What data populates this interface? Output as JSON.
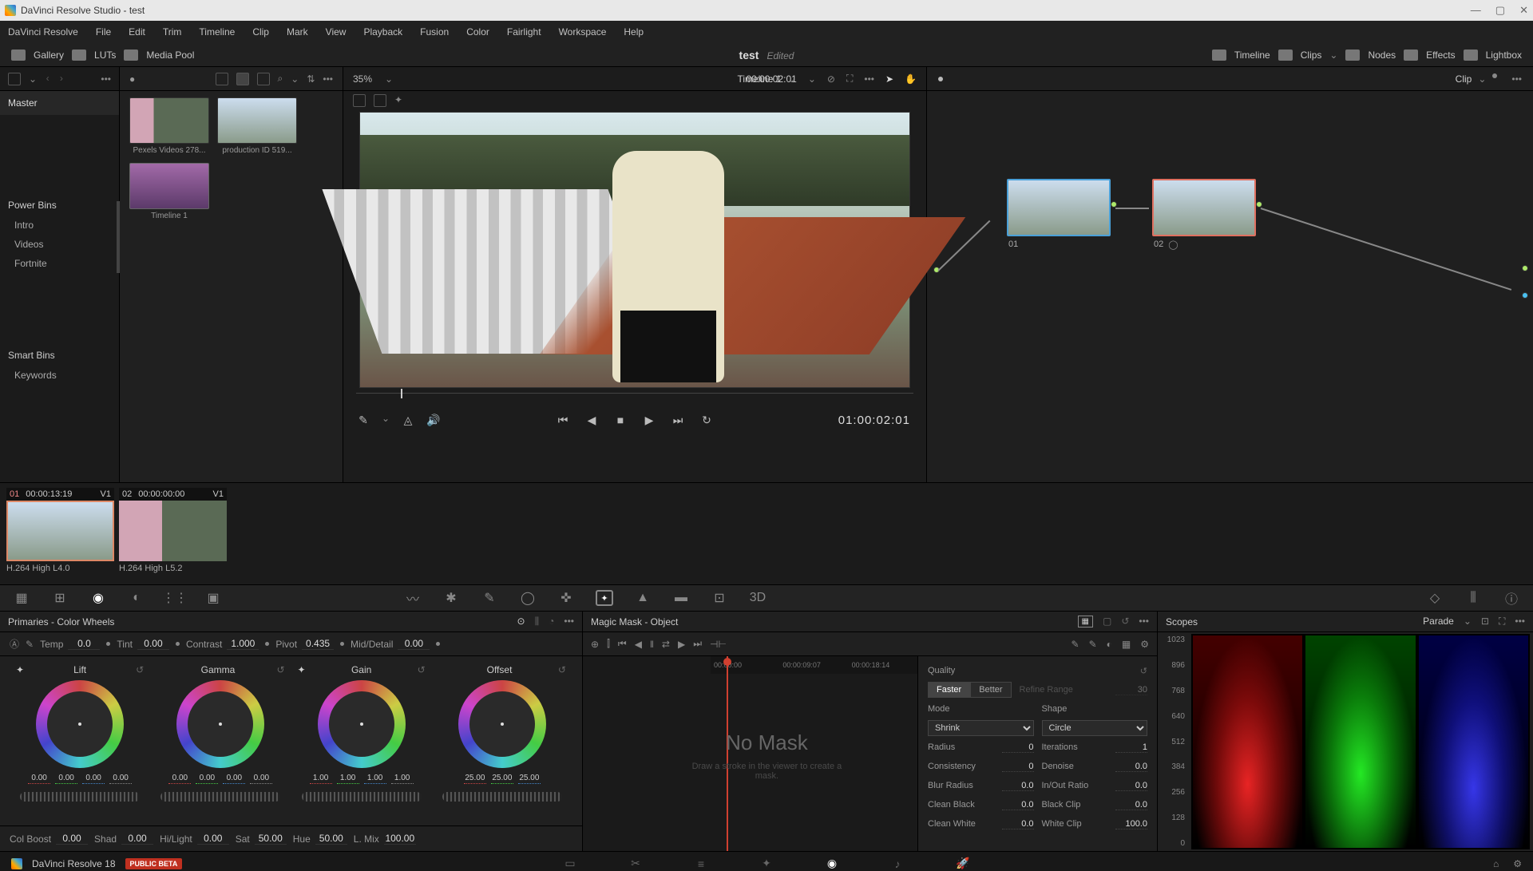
{
  "titlebar": {
    "text": "DaVinci Resolve Studio - test"
  },
  "menu": [
    "DaVinci Resolve",
    "File",
    "Edit",
    "Trim",
    "Timeline",
    "Clip",
    "Mark",
    "View",
    "Playback",
    "Fusion",
    "Color",
    "Fairlight",
    "Workspace",
    "Help"
  ],
  "toolbar": {
    "left_buttons": [
      {
        "name": "gallery",
        "label": "Gallery"
      },
      {
        "name": "luts",
        "label": "LUTs"
      },
      {
        "name": "media-pool",
        "label": "Media Pool"
      }
    ],
    "project_name": "test",
    "edited": "Edited",
    "right_buttons": [
      {
        "name": "timeline",
        "label": "Timeline"
      },
      {
        "name": "clips",
        "label": "Clips"
      },
      {
        "name": "nodes",
        "label": "Nodes"
      },
      {
        "name": "effects",
        "label": "Effects"
      },
      {
        "name": "lightbox",
        "label": "Lightbox"
      }
    ]
  },
  "sidebar": {
    "master": "Master",
    "powerbins_header": "Power Bins",
    "powerbins": [
      "Intro",
      "Videos",
      "Fortnite"
    ],
    "smartbins_header": "Smart Bins",
    "smartbins": [
      "Keywords"
    ]
  },
  "media": {
    "clips": [
      {
        "label": "Pexels Videos 278..."
      },
      {
        "label": "production ID 519..."
      },
      {
        "label": "Timeline 1"
      }
    ]
  },
  "viewer": {
    "zoom": "35%",
    "timeline_name": "Timeline 1",
    "top_tc": "00:00:02:01",
    "playback_tc": "01:00:02:01"
  },
  "nodes": {
    "mode": "Clip",
    "items": [
      {
        "id": "01"
      },
      {
        "id": "02"
      }
    ]
  },
  "clip_strip": [
    {
      "num": "01",
      "tc": "00:00:13:19",
      "track": "V1",
      "codec": "H.264 High L4.0"
    },
    {
      "num": "02",
      "tc": "00:00:00:00",
      "track": "V1",
      "codec": "H.264 High L5.2"
    }
  ],
  "primaries": {
    "header": "Primaries - Color Wheels",
    "adjust_top": [
      {
        "label": "Temp",
        "value": "0.0"
      },
      {
        "label": "Tint",
        "value": "0.00"
      },
      {
        "label": "Contrast",
        "value": "1.000"
      },
      {
        "label": "Pivot",
        "value": "0.435"
      },
      {
        "label": "Mid/Detail",
        "value": "0.00"
      }
    ],
    "wheels": [
      {
        "name": "Lift",
        "vals": [
          "0.00",
          "0.00",
          "0.00",
          "0.00"
        ]
      },
      {
        "name": "Gamma",
        "vals": [
          "0.00",
          "0.00",
          "0.00",
          "0.00"
        ]
      },
      {
        "name": "Gain",
        "vals": [
          "1.00",
          "1.00",
          "1.00",
          "1.00"
        ]
      },
      {
        "name": "Offset",
        "vals": [
          "25.00",
          "25.00",
          "25.00"
        ]
      }
    ],
    "adjust_bottom": [
      {
        "label": "Col Boost",
        "value": "0.00"
      },
      {
        "label": "Shad",
        "value": "0.00"
      },
      {
        "label": "Hi/Light",
        "value": "0.00"
      },
      {
        "label": "Sat",
        "value": "50.00"
      },
      {
        "label": "Hue",
        "value": "50.00"
      },
      {
        "label": "L. Mix",
        "value": "100.00"
      }
    ]
  },
  "mmask": {
    "header": "Magic Mask - Object",
    "timeline_ticks": [
      "00:00:00",
      "00:00:09:07",
      "00:00:18:14"
    ],
    "nomask_title": "No Mask",
    "nomask_sub": "Draw a stroke in the viewer to create a mask.",
    "quality_label": "Quality",
    "quality_options": [
      "Faster",
      "Better"
    ],
    "refine_label": "Refine Range",
    "refine_value": "30",
    "mode_label": "Mode",
    "mode_value": "Shrink",
    "shape_label": "Shape",
    "shape_value": "Circle",
    "params": [
      {
        "l": "Radius",
        "v": "0",
        "l2": "Iterations",
        "v2": "1"
      },
      {
        "l": "Consistency",
        "v": "0",
        "l2": "Denoise",
        "v2": "0.0"
      },
      {
        "l": "Blur Radius",
        "v": "0.0",
        "l2": "In/Out Ratio",
        "v2": "0.0"
      },
      {
        "l": "Clean Black",
        "v": "0.0",
        "l2": "Black Clip",
        "v2": "0.0"
      },
      {
        "l": "Clean White",
        "v": "0.0",
        "l2": "White Clip",
        "v2": "100.0"
      }
    ]
  },
  "scopes": {
    "header": "Scopes",
    "mode": "Parade",
    "scale": [
      "1023",
      "896",
      "768",
      "640",
      "512",
      "384",
      "256",
      "128",
      "0"
    ]
  },
  "footer": {
    "app": "DaVinci Resolve 18",
    "beta": "PUBLIC BETA"
  }
}
